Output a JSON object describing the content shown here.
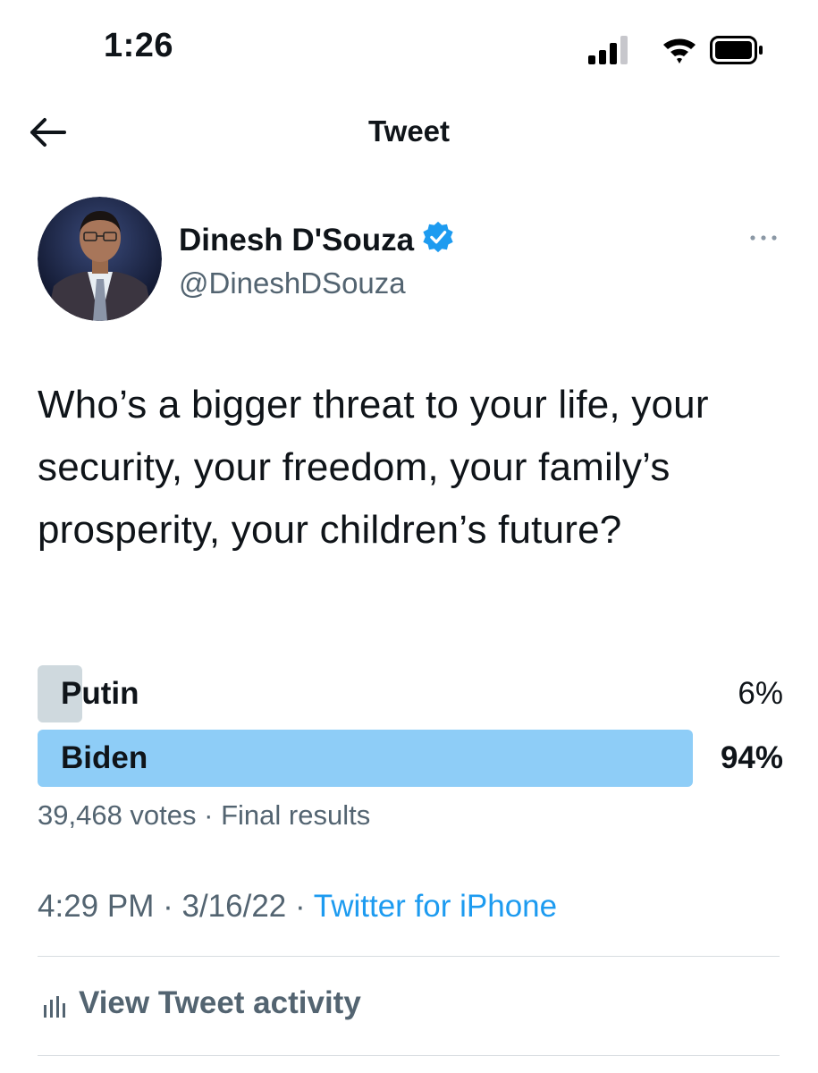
{
  "status_bar": {
    "time": "1:26",
    "icons": [
      "cellular-signal-icon",
      "wifi-icon",
      "battery-icon"
    ]
  },
  "nav": {
    "back_icon": "arrow-left-icon",
    "title": "Tweet"
  },
  "author": {
    "name": "Dinesh D'Souza",
    "verified": true,
    "handle": "@DineshDSouza",
    "more_icon": "more-horizontal-icon"
  },
  "tweet": {
    "text": "Who’s a bigger threat to your life, your security, your freedom, your family’s prosperity, your children’s future?"
  },
  "poll": {
    "options": [
      {
        "label": "Putin",
        "percent_text": "6%",
        "percent": 6,
        "winner": false
      },
      {
        "label": "Biden",
        "percent_text": "94%",
        "percent": 94,
        "winner": true
      }
    ],
    "votes": "39,468 votes",
    "status": "Final results"
  },
  "meta": {
    "time": "4:29 PM",
    "date": "3/16/22",
    "source": "Twitter for iPhone"
  },
  "activity": {
    "icon": "bar-chart-icon",
    "label": "View Tweet activity"
  },
  "colors": {
    "accent": "#1d9bf0",
    "winner_fill": "#8ecdf7",
    "loser_fill": "#cfd9de",
    "secondary_text": "#536471"
  }
}
